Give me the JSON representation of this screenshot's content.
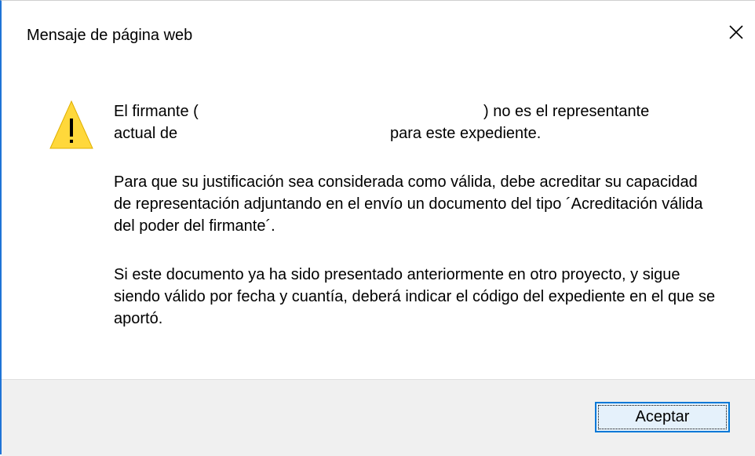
{
  "dialog": {
    "title": "Mensaje de página web",
    "close_icon": "close-icon",
    "warning_icon": "warning-icon",
    "accent_color": "#0078d7",
    "warning_color": "#ffd83b"
  },
  "message": {
    "line1_start": "El firmante (",
    "line1_end": ") no es el representante",
    "line2_start": "actual de",
    "line2_end": "para este expediente.",
    "paragraph2": "Para que su justificación sea considerada como válida, debe acreditar su capacidad de representación adjuntando en el envío un documento del tipo ´Acreditación válida del poder del firmante´.",
    "paragraph3": "Si este documento ya ha sido presentado anteriormente en otro proyecto, y sigue siendo válido por fecha y cuantía, deberá indicar el código del expediente en el que se aportó."
  },
  "footer": {
    "accept_label": "Aceptar"
  }
}
